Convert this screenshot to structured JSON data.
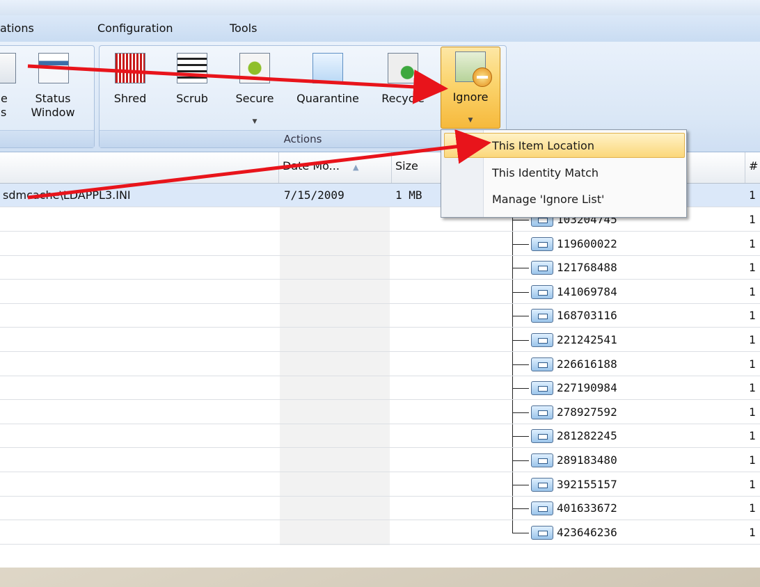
{
  "menubar": {
    "items": [
      "ations",
      "Configuration",
      "Tools"
    ]
  },
  "ribbon": {
    "view_group": {
      "buttons": [
        {
          "label_1": "e",
          "label_2": "s"
        },
        {
          "label_1": "Status",
          "label_2": "Window"
        }
      ]
    },
    "actions_group": {
      "label": "Actions",
      "buttons": [
        {
          "label": "Shred",
          "icon": "shred-icon",
          "has_caret": false
        },
        {
          "label": "Scrub",
          "icon": "scrub-icon",
          "has_caret": false
        },
        {
          "label": "Secure",
          "icon": "secure-icon",
          "has_caret": true
        },
        {
          "label": "Quarantine",
          "icon": "quarantine-icon",
          "has_caret": false
        },
        {
          "label": "Recycle",
          "icon": "recycle-icon",
          "has_caret": false
        },
        {
          "label": "Ignore",
          "icon": "ignore-icon",
          "has_caret": true,
          "active": true
        }
      ]
    }
  },
  "list": {
    "columns": {
      "date": "Date Mo...",
      "size": "Size",
      "count": "#"
    },
    "selected_row": {
      "path": "sdmcache\\LDAPPL3.INI",
      "date": "7/15/2009",
      "size": "1 MB",
      "count": "1"
    },
    "tree_nodes": [
      {
        "label": "103204745",
        "count": "1"
      },
      {
        "label": "119600022",
        "count": "1"
      },
      {
        "label": "121768488",
        "count": "1"
      },
      {
        "label": "141069784",
        "count": "1"
      },
      {
        "label": "168703116",
        "count": "1"
      },
      {
        "label": "221242541",
        "count": "1"
      },
      {
        "label": "226616188",
        "count": "1"
      },
      {
        "label": "227190984",
        "count": "1"
      },
      {
        "label": "278927592",
        "count": "1"
      },
      {
        "label": "281282245",
        "count": "1"
      },
      {
        "label": "289183480",
        "count": "1"
      },
      {
        "label": "392155157",
        "count": "1"
      },
      {
        "label": "401633672",
        "count": "1"
      },
      {
        "label": "423646236",
        "count": "1"
      }
    ]
  },
  "dropdown": {
    "items": [
      "This Item Location",
      "This Identity Match",
      "Manage 'Ignore List'"
    ],
    "highlighted_index": 0
  },
  "colors": {
    "arrow": "#e8141b",
    "ribbon_active": "#f6b93c",
    "selection": "#dbe8f9"
  }
}
